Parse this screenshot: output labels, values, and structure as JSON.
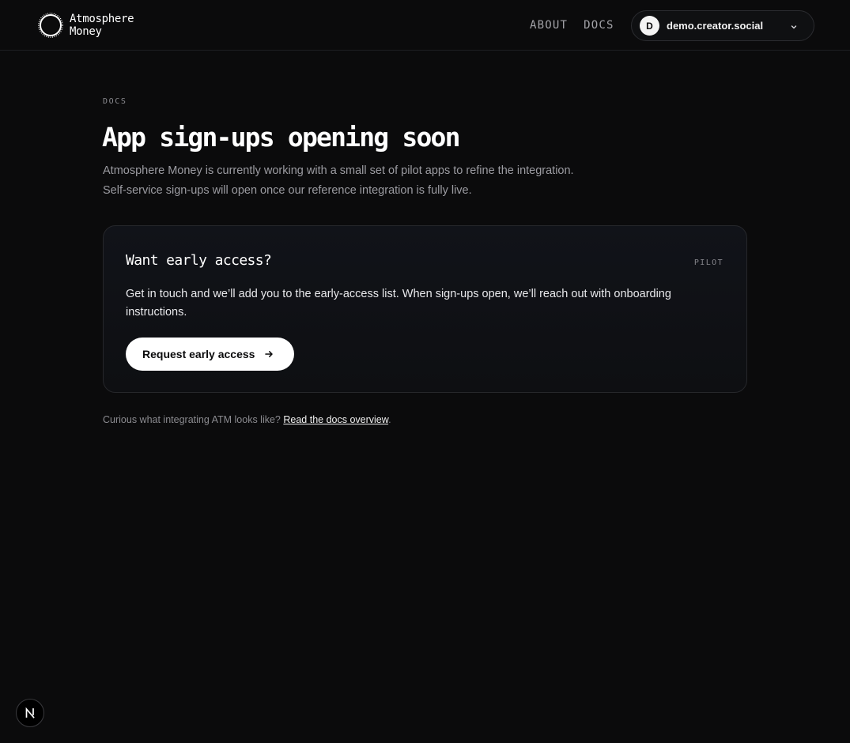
{
  "header": {
    "brand_line1": "Atmosphere",
    "brand_line2": "Money",
    "nav": [
      {
        "label": "ABOUT"
      },
      {
        "label": "DOCS"
      }
    ],
    "account": {
      "initial": "D",
      "handle": "demo.creator.social"
    }
  },
  "main": {
    "eyebrow": "DOCS",
    "title": "App sign-ups opening soon",
    "lede": "Atmosphere Money is currently working with a small set of pilot apps to refine the integration. Self-service sign-ups will open once our reference integration is fully live.",
    "card": {
      "title": "Want early access?",
      "badge": "PILOT",
      "body": "Get in touch and we’ll add you to the early-access list. When sign-ups open, we’ll reach out with onboarding instructions.",
      "cta_label": "Request early access"
    },
    "footnote": {
      "prefix": "Curious what integrating ATM looks like?",
      "link": "Read the docs overview",
      "suffix": "."
    }
  },
  "dev_badge": {
    "letter": "N"
  },
  "colors": {
    "background": "#0b0b0c",
    "card": "#111319",
    "button": "#ffffff"
  }
}
